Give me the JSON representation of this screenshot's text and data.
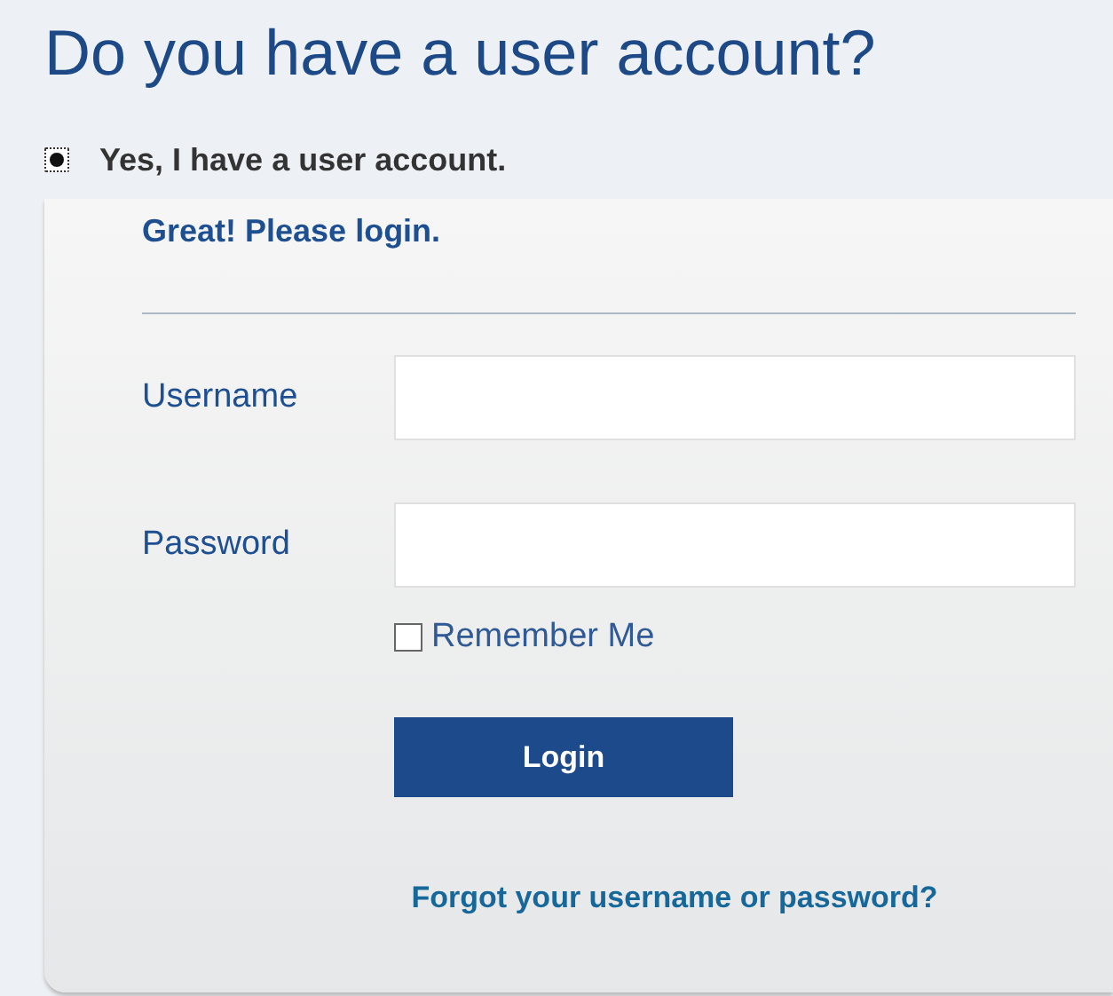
{
  "heading": "Do you have a user account?",
  "account_option": {
    "label": "Yes, I have a user account.",
    "selected": true
  },
  "login_panel": {
    "title": "Great! Please login.",
    "fields": [
      {
        "label": "Username"
      },
      {
        "label": "Password"
      }
    ],
    "remember": {
      "label": "Remember Me",
      "checked": false
    },
    "button": "Login",
    "forgot_link": "Forgot your username or password?"
  }
}
